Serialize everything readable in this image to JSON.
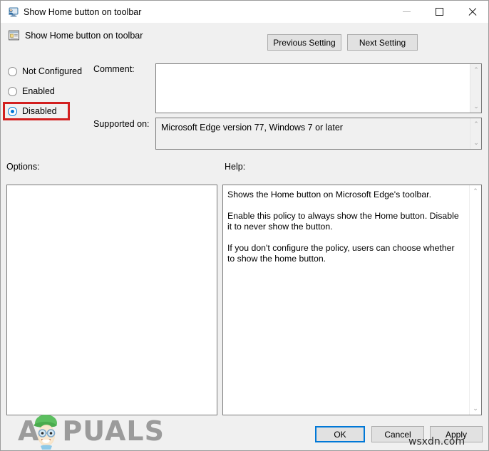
{
  "window": {
    "title": "Show Home button on toolbar",
    "title_icon": "monitor-policy-icon",
    "controls": {
      "minimize": "minimize-icon",
      "maximize": "maximize-icon",
      "close": "close-icon"
    }
  },
  "header": {
    "icon": "policy-setting-icon",
    "title": "Show Home button on toolbar",
    "previous_setting_label": "Previous Setting",
    "next_setting_label": "Next Setting"
  },
  "state_options": {
    "items": [
      {
        "label": "Not Configured",
        "selected": false
      },
      {
        "label": "Enabled",
        "selected": false
      },
      {
        "label": "Disabled",
        "selected": true
      }
    ],
    "highlight_color": "#d21f1f"
  },
  "comment": {
    "label": "Comment:",
    "value": "",
    "placeholder": ""
  },
  "supported_on": {
    "label": "Supported on:",
    "value": "Microsoft Edge version 77, Windows 7 or later"
  },
  "options": {
    "label": "Options:",
    "content": ""
  },
  "help": {
    "label": "Help:",
    "paragraphs": [
      "Shows the Home button on Microsoft Edge's toolbar.",
      "Enable this policy to always show the Home button. Disable it to never show the button.",
      "If you don't configure the policy, users can choose whether to show the home button."
    ]
  },
  "footer": {
    "ok_label": "OK",
    "cancel_label": "Cancel",
    "apply_label": "Apply",
    "focus_color": "#0078d7"
  },
  "watermarks": {
    "appuals_prefix": "A",
    "appuals_suffix": "PUALS",
    "site": "wsxdn.com"
  },
  "scroll_glyphs": {
    "up": "⌃",
    "down": "⌄"
  }
}
